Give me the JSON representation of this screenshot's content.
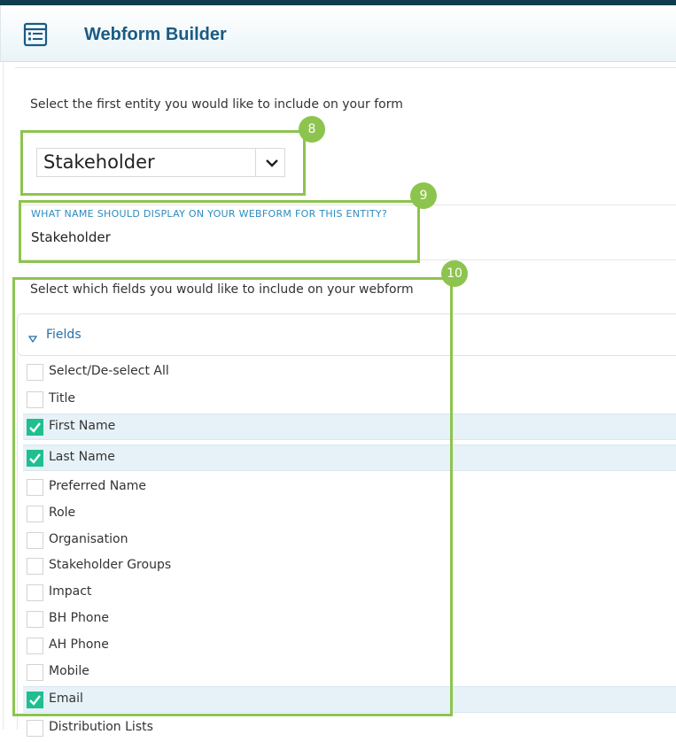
{
  "header": {
    "title": "Webform Builder",
    "icon": "webform-icon"
  },
  "entity": {
    "prompt": "Select the first entity you would like to include on your form",
    "selected": "Stakeholder",
    "badge": "8"
  },
  "display_name": {
    "caption": "WHAT NAME SHOULD DISPLAY ON YOUR WEBFORM FOR THIS ENTITY?",
    "value": "Stakeholder",
    "badge": "9"
  },
  "fields": {
    "prompt": "Select which fields you would like to include on your webform",
    "section_label": "Fields",
    "badge": "10",
    "items": [
      {
        "label": "Select/De-select All",
        "checked": false
      },
      {
        "label": "Title",
        "checked": false
      },
      {
        "label": "First Name",
        "checked": true
      },
      {
        "label": "Last Name",
        "checked": true
      },
      {
        "label": "Preferred Name",
        "checked": false
      },
      {
        "label": "Role",
        "checked": false
      },
      {
        "label": "Organisation",
        "checked": false
      },
      {
        "label": "Stakeholder Groups",
        "checked": false
      },
      {
        "label": "Impact",
        "checked": false
      },
      {
        "label": "BH Phone",
        "checked": false
      },
      {
        "label": "AH Phone",
        "checked": false
      },
      {
        "label": "Mobile",
        "checked": false
      },
      {
        "label": "Email",
        "checked": true
      },
      {
        "label": "Distribution Lists",
        "checked": false
      }
    ]
  },
  "colors": {
    "accent": "#1a5b83",
    "annotation": "#8dc44e",
    "check": "#1fbf8f",
    "selected_row": "#e6f2f8"
  }
}
